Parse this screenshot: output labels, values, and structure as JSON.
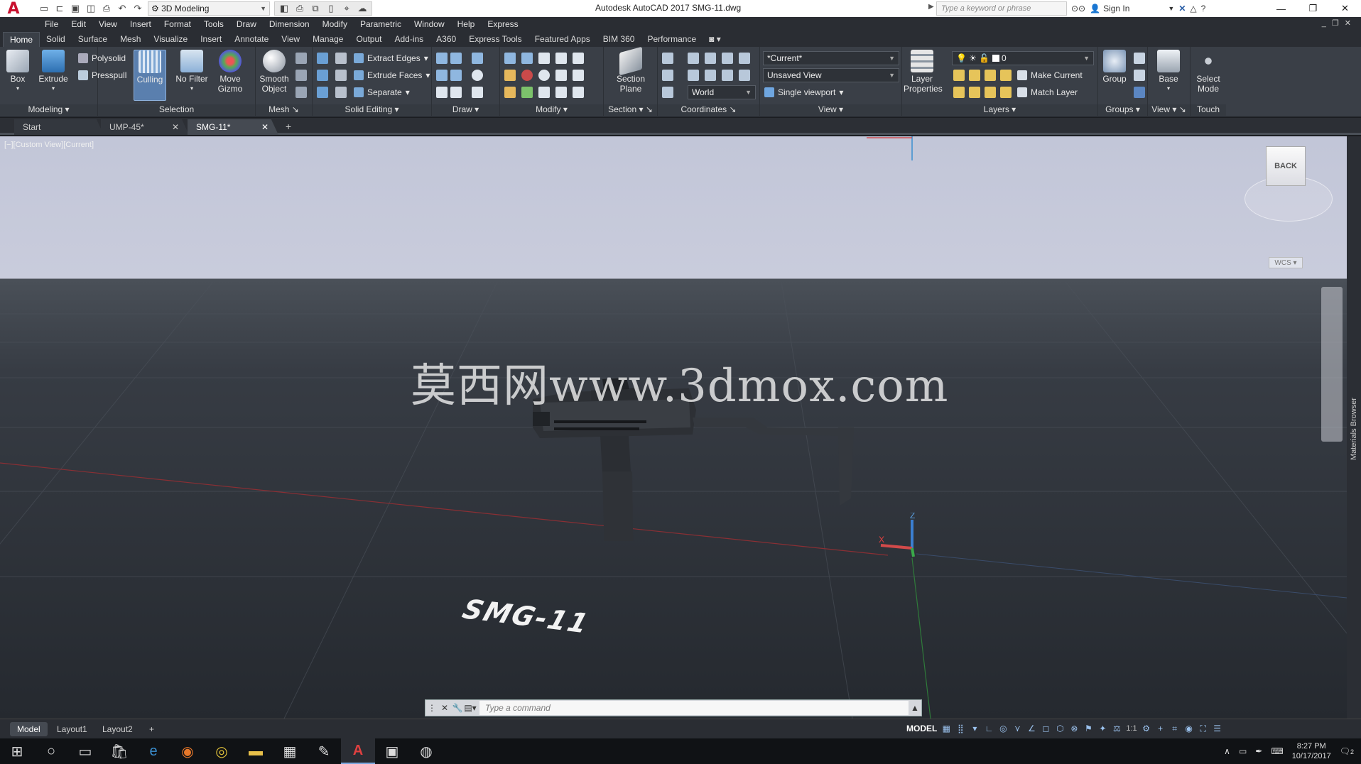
{
  "app": {
    "logo_letter": "A",
    "title": "Autodesk AutoCAD 2017    SMG-11.dwg",
    "workspace": "3D Modeling",
    "search_placeholder": "Type a keyword or phrase",
    "sign_in": "Sign In"
  },
  "menu": [
    "File",
    "Edit",
    "View",
    "Insert",
    "Format",
    "Tools",
    "Draw",
    "Dimension",
    "Modify",
    "Parametric",
    "Window",
    "Help",
    "Express"
  ],
  "ribbon_tabs": [
    "Home",
    "Solid",
    "Surface",
    "Mesh",
    "Visualize",
    "Insert",
    "Annotate",
    "View",
    "Manage",
    "Output",
    "Add-ins",
    "A360",
    "Express Tools",
    "Featured Apps",
    "BIM 360",
    "Performance"
  ],
  "ribbon": {
    "modeling": {
      "box": "Box",
      "extrude": "Extrude",
      "polysolid": "Polysolid",
      "presspull": "Presspull",
      "label": "Modeling"
    },
    "selection": {
      "culling": "Culling",
      "no_filter": "No Filter",
      "move_gizmo_1": "Move",
      "move_gizmo_2": "Gizmo",
      "label": "Selection"
    },
    "mesh": {
      "smooth_1": "Smooth",
      "smooth_2": "Object",
      "label": "Mesh"
    },
    "solid_editing": {
      "extract_edges": "Extract Edges",
      "extrude_faces": "Extrude Faces",
      "separate": "Separate",
      "label": "Solid Editing"
    },
    "draw": {
      "label": "Draw"
    },
    "modify": {
      "label": "Modify"
    },
    "section": {
      "plane_1": "Section",
      "plane_2": "Plane",
      "label": "Section"
    },
    "coordinates": {
      "world": "World",
      "label": "Coordinates"
    },
    "view": {
      "visual_style": "*Current*",
      "named_view": "Unsaved View",
      "viewport": "Single viewport",
      "label": "View"
    },
    "layers": {
      "props_1": "Layer",
      "props_2": "Properties",
      "layer_name": "0",
      "make_current": "Make Current",
      "match_layer": "Match Layer",
      "label": "Layers"
    },
    "groups": {
      "group": "Group",
      "label": "Groups"
    },
    "view2": {
      "base": "Base",
      "label": "View"
    },
    "touch": {
      "select_1": "Select",
      "select_2": "Mode",
      "label": "Touch"
    }
  },
  "doc_tabs": [
    "Start",
    "UMP-45*",
    "SMG-11*"
  ],
  "viewport": {
    "label": "[−][Custom View][Current]",
    "viewcube_face": "BACK",
    "wcs": "WCS",
    "watermark": "莫西网www.3dmox.com",
    "model_text": "SMG-11",
    "axis_x": "X",
    "axis_z": "Z",
    "side_panel": "Materials Browser"
  },
  "command": {
    "placeholder": "Type a command"
  },
  "layouts": [
    "Model",
    "Layout1",
    "Layout2"
  ],
  "status": {
    "mode": "MODEL",
    "scale": "1:1"
  },
  "taskbar": {
    "time": "8:27 PM",
    "date": "10/17/2017",
    "notifications": "2"
  }
}
